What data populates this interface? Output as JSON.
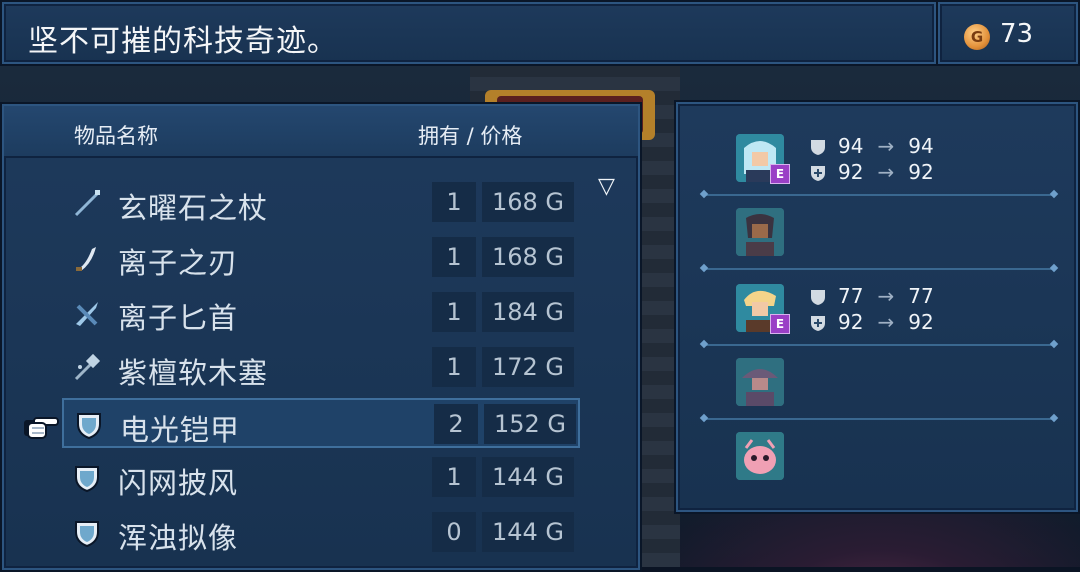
{
  "title": "坚不可摧的科技奇迹。",
  "gold": {
    "coin_symbol": "G",
    "amount": "73"
  },
  "shop": {
    "header_name": "物品名称",
    "header_owned_price": "拥有 / 价格",
    "items": [
      {
        "name": "玄曜石之杖",
        "owned": "1",
        "price": "168 G",
        "icon": "staff-icon"
      },
      {
        "name": "离子之刃",
        "owned": "1",
        "price": "168 G",
        "icon": "blade-icon"
      },
      {
        "name": "离子匕首",
        "owned": "1",
        "price": "184 G",
        "icon": "dagger-icon"
      },
      {
        "name": "紫檀软木塞",
        "owned": "1",
        "price": "172 G",
        "icon": "cork-icon"
      },
      {
        "name": "电光铠甲",
        "owned": "2",
        "price": "152 G",
        "icon": "armor-icon"
      },
      {
        "name": "闪网披风",
        "owned": "1",
        "price": "144 G",
        "icon": "armor-icon"
      },
      {
        "name": "浑浊拟像",
        "owned": "0",
        "price": "144 G",
        "icon": "armor-icon"
      }
    ],
    "selected_index": 4
  },
  "party": [
    {
      "portrait": "blue-hair-character",
      "equipped_badge": "E",
      "def_from": "94",
      "def_to": "94",
      "mdef_from": "92",
      "mdef_to": "92"
    },
    {
      "portrait": "hooded-warrior-character"
    },
    {
      "portrait": "blonde-character",
      "equipped_badge": "E",
      "def_from": "77",
      "def_to": "77",
      "mdef_from": "92",
      "mdef_to": "92"
    },
    {
      "portrait": "purple-hat-character"
    },
    {
      "portrait": "pink-creature-character"
    }
  ],
  "arrow_symbol": "→",
  "scroll_symbol": "▽",
  "colors": {
    "panel": "#1e3a5c",
    "badge": "#9a3fc6",
    "gold": "#e3913a"
  }
}
